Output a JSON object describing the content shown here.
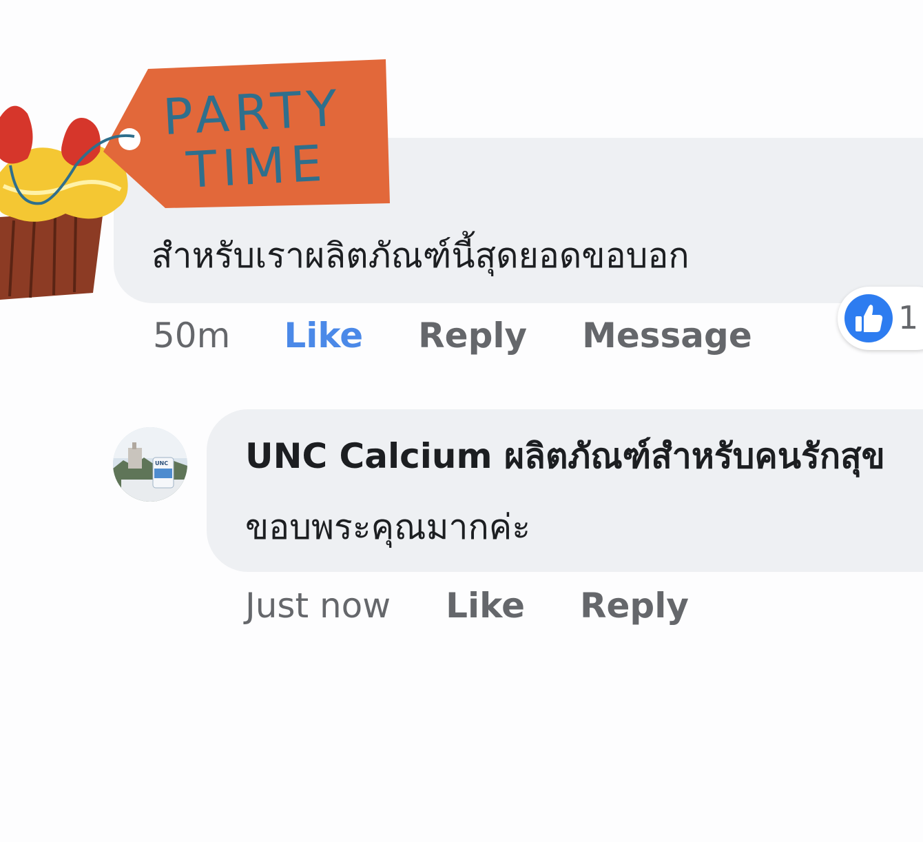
{
  "sticker": {
    "line1": "PARTY",
    "line2": "TIME"
  },
  "comment1": {
    "text": "สำหรับเราผลิตภัณฑ์นี้สุดยอดขอบอก",
    "time": "50m",
    "like_label": "Like",
    "reply_label": "Reply",
    "message_label": "Message",
    "reaction": {
      "icon": "thumbs-up-icon",
      "count": "1"
    }
  },
  "comment2": {
    "author": "UNC Calcium ผลิตภัณฑ์สำหรับคนรักสุข",
    "text": "ขอบพระคุณมากค่ะ",
    "time": "Just now",
    "like_label": "Like",
    "reply_label": "Reply",
    "avatar_label": "UNC"
  },
  "colors": {
    "bubble": "#eef0f3",
    "like_active": "#4b89e8",
    "muted_text": "#65676b",
    "tag_orange": "#e2683a",
    "tag_text": "#2f6f8c",
    "reaction_blue": "#2d7cf0"
  }
}
